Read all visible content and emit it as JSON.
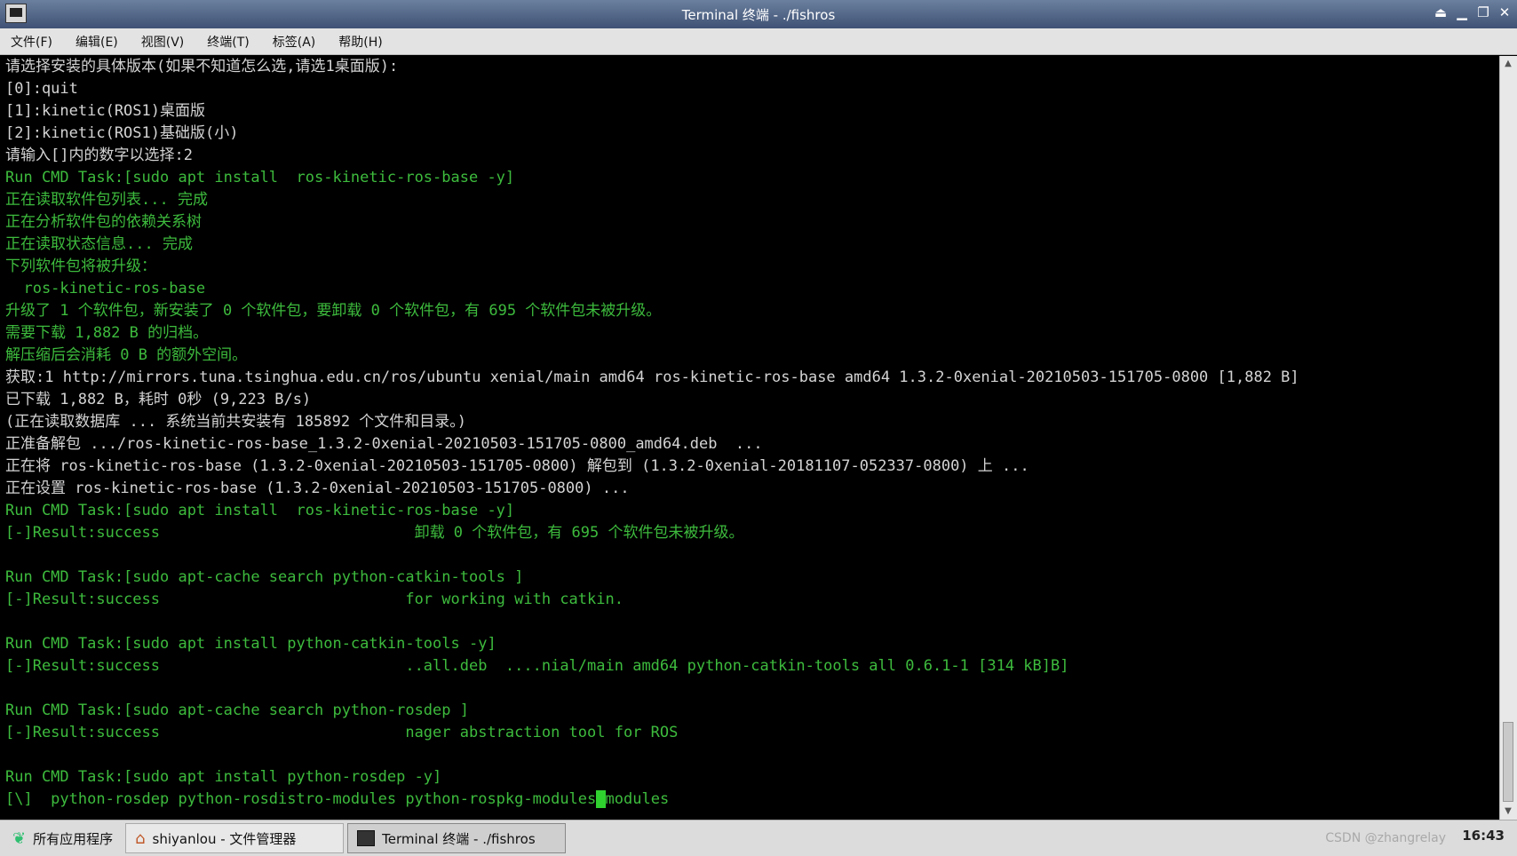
{
  "window": {
    "title": "Terminal 终端 - ./fishros"
  },
  "menubar": {
    "items": [
      "文件(F)",
      "编辑(E)",
      "视图(V)",
      "终端(T)",
      "标签(A)",
      "帮助(H)"
    ]
  },
  "terminal": {
    "lines": [
      {
        "text": "请选择安装的具体版本(如果不知道怎么选,请选1桌面版):",
        "color": "white"
      },
      {
        "text": "[0]:quit",
        "color": "white"
      },
      {
        "text": "[1]:kinetic(ROS1)桌面版",
        "color": "white"
      },
      {
        "text": "[2]:kinetic(ROS1)基础版(小)",
        "color": "white"
      },
      {
        "text": "请输入[]内的数字以选择:2",
        "color": "white"
      },
      {
        "text": "Run CMD Task:[sudo apt install  ros-kinetic-ros-base -y]",
        "color": "green"
      },
      {
        "text": "正在读取软件包列表... 完成",
        "color": "green"
      },
      {
        "text": "正在分析软件包的依赖关系树",
        "color": "green"
      },
      {
        "text": "正在读取状态信息... 完成",
        "color": "green"
      },
      {
        "text": "下列软件包将被升级：",
        "color": "green"
      },
      {
        "text": "  ros-kinetic-ros-base",
        "color": "green"
      },
      {
        "text": "升级了 1 个软件包，新安装了 0 个软件包，要卸载 0 个软件包，有 695 个软件包未被升级。",
        "color": "green"
      },
      {
        "text": "需要下载 1,882 B 的归档。",
        "color": "green"
      },
      {
        "text": "解压缩后会消耗 0 B 的额外空间。",
        "color": "green"
      },
      {
        "text": "获取:1 http://mirrors.tuna.tsinghua.edu.cn/ros/ubuntu xenial/main amd64 ros-kinetic-ros-base amd64 1.3.2-0xenial-20210503-151705-0800 [1,882 B]",
        "color": "white"
      },
      {
        "text": "已下载 1,882 B，耗时 0秒 (9,223 B/s)",
        "color": "white"
      },
      {
        "text": "(正在读取数据库 ... 系统当前共安装有 185892 个文件和目录。)",
        "color": "white"
      },
      {
        "text": "正准备解包 .../ros-kinetic-ros-base_1.3.2-0xenial-20210503-151705-0800_amd64.deb  ...",
        "color": "white"
      },
      {
        "text": "正在将 ros-kinetic-ros-base (1.3.2-0xenial-20210503-151705-0800) 解包到 (1.3.2-0xenial-20181107-052337-0800) 上 ...",
        "color": "white"
      },
      {
        "text": "正在设置 ros-kinetic-ros-base (1.3.2-0xenial-20210503-151705-0800) ...",
        "color": "white"
      },
      {
        "text": "Run CMD Task:[sudo apt install  ros-kinetic-ros-base -y]",
        "color": "green"
      },
      {
        "text": "[-]Result:success                            卸载 0 个软件包，有 695 个软件包未被升级。",
        "color": "green"
      },
      {
        "text": "",
        "color": "green"
      },
      {
        "text": "Run CMD Task:[sudo apt-cache search python-catkin-tools ]",
        "color": "green"
      },
      {
        "text": "[-]Result:success                           for working with catkin.",
        "color": "green"
      },
      {
        "text": "",
        "color": "green"
      },
      {
        "text": "Run CMD Task:[sudo apt install python-catkin-tools -y]",
        "color": "green"
      },
      {
        "text": "[-]Result:success                           ..all.deb  ....nial/main amd64 python-catkin-tools all 0.6.1-1 [314 kB]B]",
        "color": "green"
      },
      {
        "text": "",
        "color": "green"
      },
      {
        "text": "Run CMD Task:[sudo apt-cache search python-rosdep ]",
        "color": "green"
      },
      {
        "text": "[-]Result:success                           nager abstraction tool for ROS",
        "color": "green"
      },
      {
        "text": "",
        "color": "green"
      },
      {
        "text": "Run CMD Task:[sudo apt install python-rosdep -y]",
        "color": "green"
      }
    ],
    "last_line_before_cursor": "[\\]  python-rosdep python-rosdistro-modules python-rospkg-modules",
    "last_line_after_cursor": "modules"
  },
  "taskbar": {
    "apps_label": "所有应用程序",
    "tasks": [
      {
        "label": "shiyanlou - 文件管理器",
        "icon": "home-icon"
      },
      {
        "label": "Terminal 终端 - ./fishros",
        "icon": "terminal-icon"
      }
    ],
    "clock": "16:43",
    "watermark": "CSDN @zhangrelay"
  },
  "colors": {
    "terminal_bg": "#000000",
    "text_white": "#d4d4d4",
    "text_green": "#3dbb3d",
    "cursor": "#2fd12f"
  }
}
